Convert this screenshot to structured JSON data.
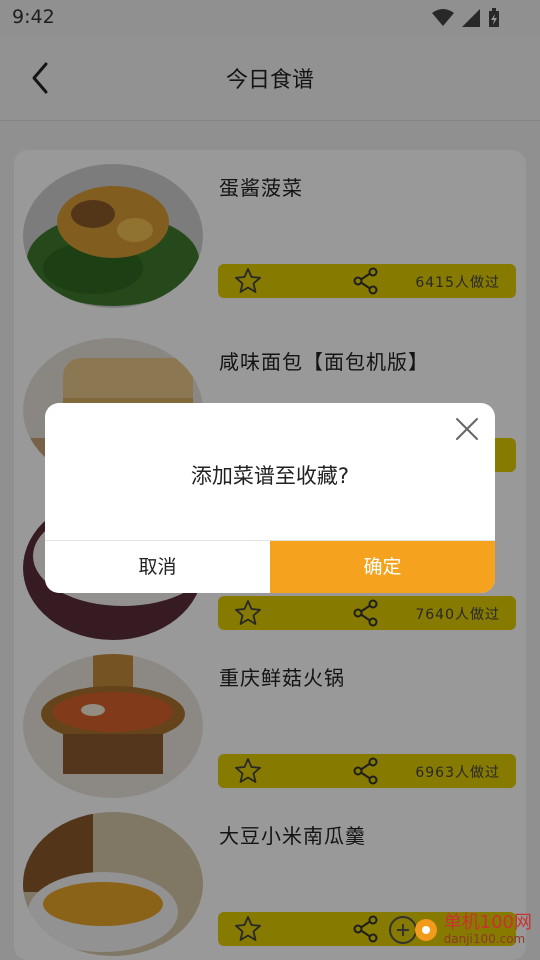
{
  "status": {
    "time": "9:42"
  },
  "header": {
    "title": "今日食谱"
  },
  "recipes": [
    {
      "name": "蛋酱菠菜",
      "count": "6415人做过"
    },
    {
      "name": "咸味面包【面包机版】",
      "count": ""
    },
    {
      "name": "",
      "count": "7640人做过"
    },
    {
      "name": "重庆鲜菇火锅",
      "count": "6963人做过"
    },
    {
      "name": "大豆小米南瓜羹",
      "count": ""
    }
  ],
  "dialog": {
    "message": "添加菜谱至收藏?",
    "cancel_label": "取消",
    "confirm_label": "确定"
  },
  "watermark": {
    "title": "单机100网",
    "url": "danji100.com"
  },
  "colors": {
    "accent": "#f5a21e",
    "action_bar": "#dfcc00"
  }
}
